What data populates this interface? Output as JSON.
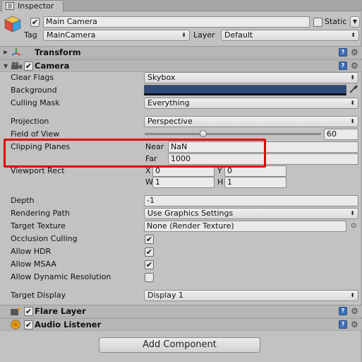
{
  "tab": {
    "label": "Inspector",
    "icon": "inspector-icon"
  },
  "header": {
    "object_name": "Main Camera",
    "static_label": "Static",
    "tag_label": "Tag",
    "tag_value": "MainCamera",
    "layer_label": "Layer",
    "layer_value": "Default"
  },
  "transform": {
    "title": "Transform"
  },
  "camera": {
    "title": "Camera",
    "clear_flags": {
      "label": "Clear Flags",
      "value": "Skybox"
    },
    "background": {
      "label": "Background",
      "color": "#2e4a7a"
    },
    "culling_mask": {
      "label": "Culling Mask",
      "value": "Everything"
    },
    "projection": {
      "label": "Projection",
      "value": "Perspective"
    },
    "field_of_view": {
      "label": "Field of View",
      "value": "60",
      "slider_fraction": 0.33
    },
    "clipping_planes": {
      "label": "Clipping Planes",
      "near_label": "Near",
      "near_value": "NaN",
      "far_label": "Far",
      "far_value": "1000"
    },
    "viewport_rect": {
      "label": "Viewport Rect",
      "x_label": "X",
      "x_value": "0",
      "y_label": "Y",
      "y_value": "0",
      "w_label": "W",
      "w_value": "1",
      "h_label": "H",
      "h_value": "1"
    },
    "depth": {
      "label": "Depth",
      "value": "-1"
    },
    "rendering_path": {
      "label": "Rendering Path",
      "value": "Use Graphics Settings"
    },
    "target_texture": {
      "label": "Target Texture",
      "value": "None (Render Texture)"
    },
    "occlusion_culling": {
      "label": "Occlusion Culling"
    },
    "allow_hdr": {
      "label": "Allow HDR"
    },
    "allow_msaa": {
      "label": "Allow MSAA"
    },
    "allow_dynamic_resolution": {
      "label": "Allow Dynamic Resolution"
    },
    "target_display": {
      "label": "Target Display",
      "value": "Display 1"
    }
  },
  "flare_layer": {
    "title": "Flare Layer"
  },
  "audio_listener": {
    "title": "Audio Listener"
  },
  "add_component_label": "Add Component",
  "check_glyph": "✔",
  "colors": {
    "annotation_red": "#e00000",
    "panel_bg": "#c2c2c2"
  }
}
